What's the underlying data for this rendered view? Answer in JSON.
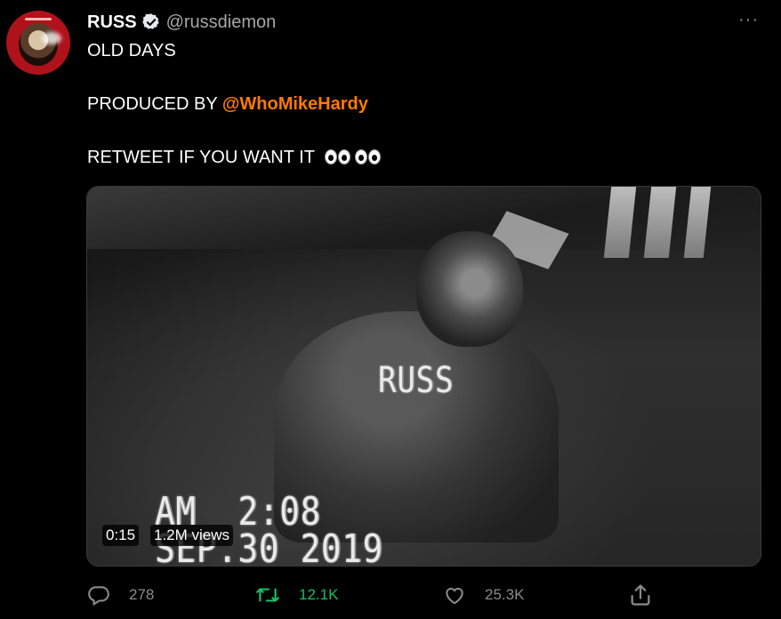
{
  "tweet": {
    "display_name": "RUSS",
    "handle": "@russdiemon",
    "more_label": "···",
    "lines": {
      "line1": "OLD DAYS",
      "line2_prefix": "PRODUCED BY ",
      "line2_mention": "@WhoMikeHardy",
      "line3": "RETWEET IF YOU WANT IT"
    }
  },
  "media": {
    "overlay_name": "RUSS",
    "overlay_time": "AM  2:08",
    "overlay_date": "SEP.30 2019",
    "duration": "0:15",
    "views": "1.2M views"
  },
  "actions": {
    "reply_count": "278",
    "retweet_count": "12.1K",
    "like_count": "25.3K"
  },
  "colors": {
    "mention": "#ff7a00",
    "retweet": "#17bf63",
    "background": "#000000"
  },
  "icons": {
    "verified": "verified-badge-icon",
    "reply": "reply-icon",
    "retweet": "retweet-icon",
    "like": "heart-icon",
    "share": "share-icon",
    "more": "more-icon"
  }
}
